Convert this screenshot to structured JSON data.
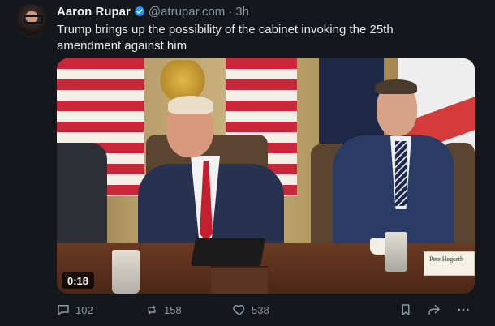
{
  "post": {
    "author_name": "Aaron Rupar",
    "handle": "@atrupar.com",
    "separator": "·",
    "time": "3h",
    "text": "Trump brings up the possibility of the cabinet invoking the 25th amendment against him",
    "media": {
      "duration": "0:18",
      "tent_card": "Pete Hegseth"
    },
    "actions": {
      "replies": "102",
      "reposts": "158",
      "likes": "538"
    },
    "icons": {
      "avatar": "avatar",
      "verified": "verified-badge-icon",
      "reply": "reply-icon",
      "repost": "repost-icon",
      "like": "heart-icon",
      "bookmark": "bookmark-icon",
      "share": "share-icon",
      "more": "more-icon"
    },
    "colors": {
      "background": "#14171c",
      "text": "#e7e9ea",
      "muted": "#8b98a5",
      "verified": "#1d9bf0"
    }
  }
}
